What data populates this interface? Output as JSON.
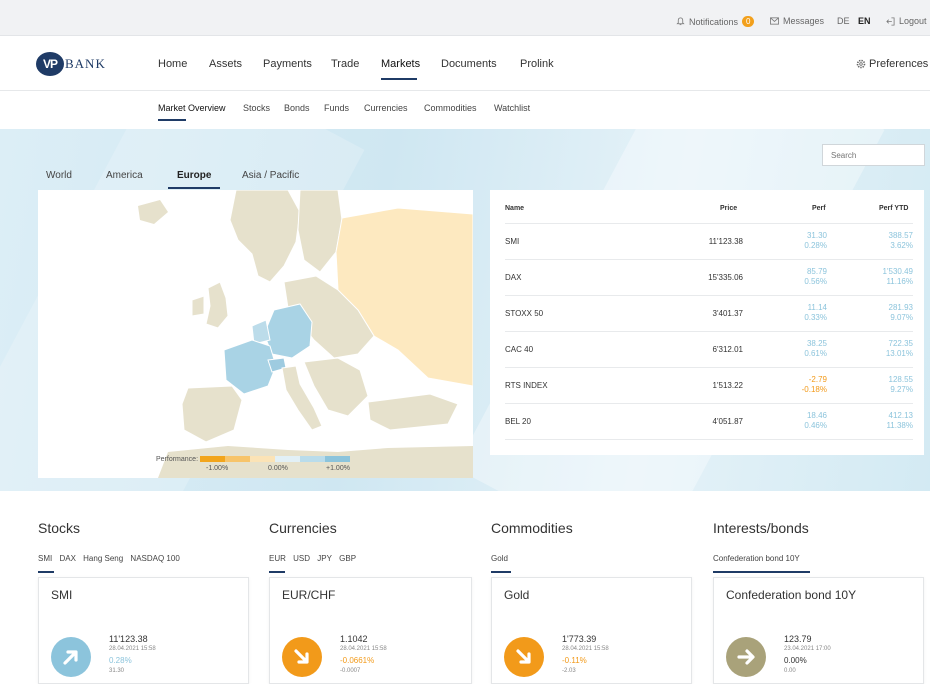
{
  "topbar": {
    "notifications_label": "Notifications",
    "notifications_count": "0",
    "messages_label": "Messages",
    "lang_de": "DE",
    "lang_en": "EN",
    "logout_label": "Logout"
  },
  "logo": {
    "mark": "VP",
    "text": "BANK"
  },
  "nav": {
    "items": [
      "Home",
      "Assets",
      "Payments",
      "Trade",
      "Markets",
      "Documents",
      "Prolink"
    ],
    "active": "Markets",
    "preferences_label": "Preferences"
  },
  "subnav": {
    "items": [
      "Market Overview",
      "Stocks",
      "Bonds",
      "Funds",
      "Currencies",
      "Commodities",
      "Watchlist"
    ],
    "active": "Market Overview"
  },
  "regions": {
    "items": [
      "World",
      "America",
      "Europe",
      "Asia / Pacific"
    ],
    "active": "Europe"
  },
  "search": {
    "placeholder": "Search"
  },
  "legend": {
    "label": "Performance:",
    "min": "-1.00%",
    "mid": "0.00%",
    "max": "+1.00%"
  },
  "colors": {
    "brand": "#1f3b66",
    "positive": "#8cc4dc",
    "negative": "#f29a1a",
    "neutral": "#a9a27a"
  },
  "indices_table": {
    "headers": [
      "Name",
      "Price",
      "Perf",
      "Perf YTD"
    ],
    "rows": [
      {
        "name": "SMI",
        "price": "11'123.38",
        "perf": "31.30",
        "perf_pct": "0.28%",
        "ytd": "388.57",
        "ytd_pct": "3.62%",
        "trend": "pos"
      },
      {
        "name": "DAX",
        "price": "15'335.06",
        "perf": "85.79",
        "perf_pct": "0.56%",
        "ytd": "1'530.49",
        "ytd_pct": "11.16%",
        "trend": "pos"
      },
      {
        "name": "STOXX 50",
        "price": "3'401.37",
        "perf": "11.14",
        "perf_pct": "0.33%",
        "ytd": "281.93",
        "ytd_pct": "9.07%",
        "trend": "pos"
      },
      {
        "name": "CAC 40",
        "price": "6'312.01",
        "perf": "38.25",
        "perf_pct": "0.61%",
        "ytd": "722.35",
        "ytd_pct": "13.01%",
        "trend": "pos"
      },
      {
        "name": "RTS INDEX",
        "price": "1'513.22",
        "perf": "-2.79",
        "perf_pct": "-0.18%",
        "ytd": "128.55",
        "ytd_pct": "9.27%",
        "trend": "neg"
      },
      {
        "name": "BEL 20",
        "price": "4'051.87",
        "perf": "18.46",
        "perf_pct": "0.46%",
        "ytd": "412.13",
        "ytd_pct": "11.38%",
        "trend": "pos"
      }
    ]
  },
  "sections": [
    {
      "title": "Stocks",
      "tabs": [
        "SMI",
        "DAX",
        "Hang Seng",
        "NASDAQ 100"
      ],
      "card": {
        "title": "SMI",
        "value": "11'123.38",
        "timestamp": "28.04.2021 15:58",
        "pct": "0.28%",
        "abs": "31.30",
        "trend": "up",
        "icon": "arrow-up-right-icon"
      }
    },
    {
      "title": "Currencies",
      "tabs": [
        "EUR",
        "USD",
        "JPY",
        "GBP"
      ],
      "card": {
        "title": "EUR/CHF",
        "value": "1.1042",
        "timestamp": "28.04.2021 15:58",
        "pct": "-0.0661%",
        "abs": "-0.0007",
        "trend": "down",
        "icon": "arrow-down-right-icon"
      }
    },
    {
      "title": "Commodities",
      "tabs": [
        "Gold"
      ],
      "card": {
        "title": "Gold",
        "value": "1'773.39",
        "timestamp": "28.04.2021 15:58",
        "pct": "-0.11%",
        "abs": "-2.03",
        "trend": "down",
        "icon": "arrow-down-right-icon"
      }
    },
    {
      "title": "Interests/bonds",
      "tabs": [
        "Confederation bond 10Y"
      ],
      "card": {
        "title": "Confederation bond 10Y",
        "value": "123.79",
        "timestamp": "23.04.2021 17:00",
        "pct": "0.00%",
        "abs": "0.00",
        "trend": "flat",
        "icon": "arrow-right-icon"
      }
    }
  ]
}
